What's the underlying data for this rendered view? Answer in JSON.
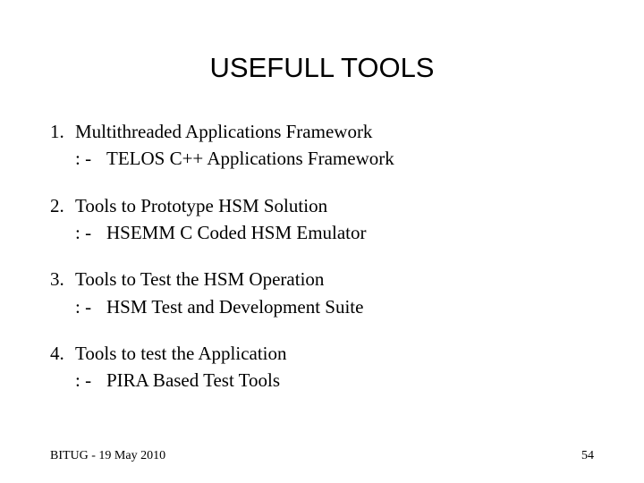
{
  "title": "USEFULL TOOLS",
  "items": [
    {
      "num": "1.",
      "text": "Multithreaded Applications Framework",
      "bullet": ": -",
      "sub": "TELOS C++ Applications Framework"
    },
    {
      "num": "2.",
      "text": "Tools to Prototype HSM Solution",
      "bullet": ": -",
      "sub": "HSEMM C Coded HSM Emulator"
    },
    {
      "num": "3.",
      "text": "Tools to Test the HSM Operation",
      "bullet": ": -",
      "sub": "HSM Test and Development Suite"
    },
    {
      "num": "4.",
      "text": "Tools to test the Application",
      "bullet": ": -",
      "sub": "PIRA Based Test Tools"
    }
  ],
  "footer": {
    "left": "BITUG - 19 May 2010",
    "right": "54"
  }
}
